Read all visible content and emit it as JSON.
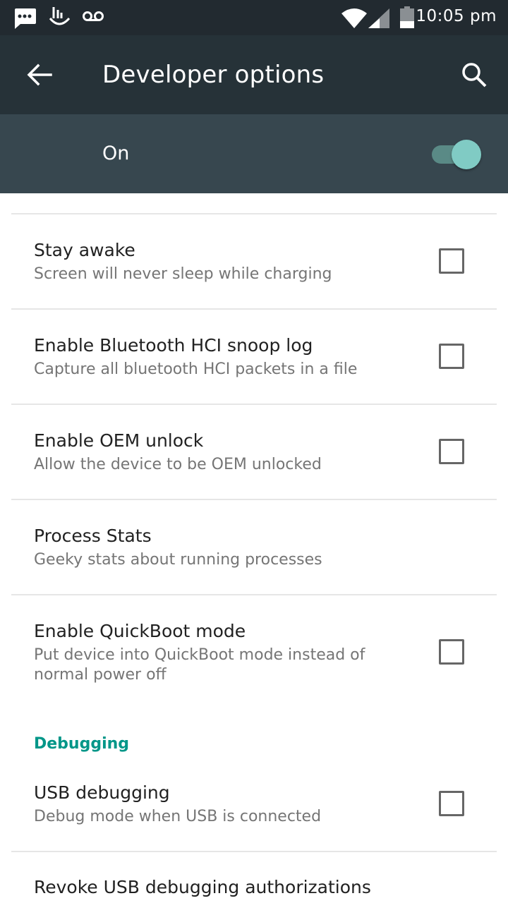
{
  "status_bar": {
    "time": "10:05 pm",
    "icons": [
      "message-icon",
      "touchpal-icon",
      "voicemail-icon",
      "wifi-icon",
      "signal-icon",
      "battery-icon"
    ]
  },
  "app_bar": {
    "title": "Developer options",
    "back_icon": "arrow-back-icon",
    "search_icon": "search-icon"
  },
  "master_switch": {
    "label": "On",
    "state": "on",
    "accent": "#80cbc4"
  },
  "items": [
    {
      "title": "Stay awake",
      "subtitle": "Screen will never sleep while charging",
      "checkbox": true,
      "checked": false
    },
    {
      "title": "Enable Bluetooth HCI snoop log",
      "subtitle": "Capture all bluetooth HCI packets in a file",
      "checkbox": true,
      "checked": false
    },
    {
      "title": "Enable OEM unlock",
      "subtitle": "Allow the device to be OEM unlocked",
      "checkbox": true,
      "checked": false
    },
    {
      "title": "Process Stats",
      "subtitle": "Geeky stats about running processes",
      "checkbox": false
    },
    {
      "title": "Enable QuickBoot mode",
      "subtitle": "Put device into QuickBoot mode instead of normal power off",
      "checkbox": true,
      "checked": false
    }
  ],
  "debugging_section": {
    "header": "Debugging",
    "header_color": "#009688",
    "items": [
      {
        "title": "USB debugging",
        "subtitle": "Debug mode when USB is connected",
        "checkbox": true,
        "checked": false
      },
      {
        "title": "Revoke USB debugging authorizations"
      }
    ]
  }
}
